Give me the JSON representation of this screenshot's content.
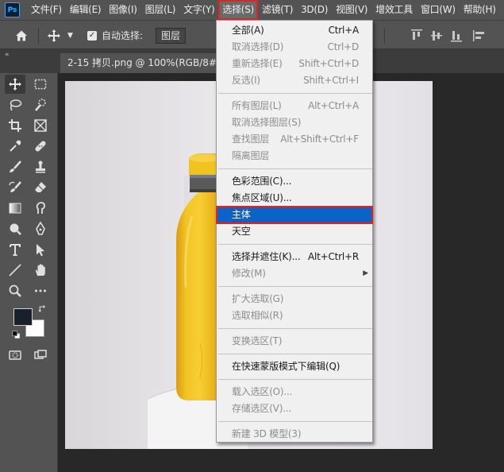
{
  "app": {
    "logo_text": "Ps"
  },
  "menubar": {
    "items": [
      "文件(F)",
      "编辑(E)",
      "图像(I)",
      "图层(L)",
      "文字(Y)",
      "选择(S)",
      "滤镜(T)",
      "3D(D)",
      "视图(V)",
      "增效工具",
      "窗口(W)",
      "帮助(H)"
    ],
    "active_index": 5
  },
  "options": {
    "auto_select_label": "自动选择:",
    "auto_select_checked": true,
    "target_select": "图层"
  },
  "document": {
    "tab_title": "2-15 拷贝.png @ 100%(RGB/8#)"
  },
  "toolbar": {
    "foreground_color": "#18202e",
    "background_color": "#ffffff"
  },
  "select_menu": {
    "highlight_color": "#0a64c8",
    "groups": [
      [
        {
          "label": "全部(A)",
          "shortcut": "Ctrl+A",
          "enabled": true
        },
        {
          "label": "取消选择(D)",
          "shortcut": "Ctrl+D",
          "enabled": false
        },
        {
          "label": "重新选择(E)",
          "shortcut": "Shift+Ctrl+D",
          "enabled": false
        },
        {
          "label": "反选(I)",
          "shortcut": "Shift+Ctrl+I",
          "enabled": false
        }
      ],
      [
        {
          "label": "所有图层(L)",
          "shortcut": "Alt+Ctrl+A",
          "enabled": false
        },
        {
          "label": "取消选择图层(S)",
          "shortcut": "",
          "enabled": false
        },
        {
          "label": "查找图层",
          "shortcut": "Alt+Shift+Ctrl+F",
          "enabled": false
        },
        {
          "label": "隔离图层",
          "shortcut": "",
          "enabled": false
        }
      ],
      [
        {
          "label": "色彩范围(C)...",
          "shortcut": "",
          "enabled": true
        },
        {
          "label": "焦点区域(U)...",
          "shortcut": "",
          "enabled": true
        },
        {
          "label": "主体",
          "shortcut": "",
          "enabled": true,
          "highlighted": true
        },
        {
          "label": "天空",
          "shortcut": "",
          "enabled": true
        }
      ],
      [
        {
          "label": "选择并遮住(K)...",
          "shortcut": "Alt+Ctrl+R",
          "enabled": true
        },
        {
          "label": "修改(M)",
          "shortcut": "",
          "enabled": false,
          "submenu": true
        }
      ],
      [
        {
          "label": "扩大选取(G)",
          "shortcut": "",
          "enabled": false
        },
        {
          "label": "选取相似(R)",
          "shortcut": "",
          "enabled": false
        }
      ],
      [
        {
          "label": "变换选区(T)",
          "shortcut": "",
          "enabled": false
        }
      ],
      [
        {
          "label": "在快速蒙版模式下编辑(Q)",
          "shortcut": "",
          "enabled": true
        }
      ],
      [
        {
          "label": "载入选区(O)...",
          "shortcut": "",
          "enabled": false
        },
        {
          "label": "存储选区(V)...",
          "shortcut": "",
          "enabled": false
        }
      ],
      [
        {
          "label": "新建 3D 模型(3)",
          "shortcut": "",
          "enabled": false
        }
      ]
    ]
  }
}
